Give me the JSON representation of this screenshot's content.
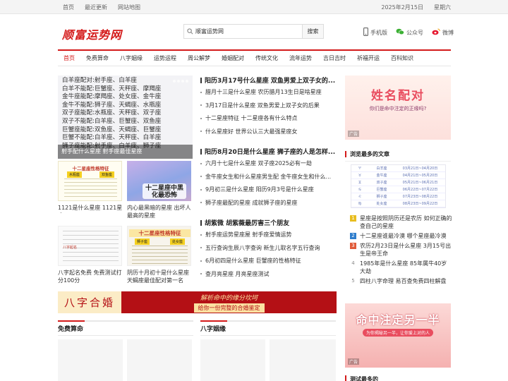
{
  "topbar": {
    "links": [
      "首页",
      "最近更新",
      "网站地图"
    ],
    "date": "2025年2月15日",
    "weekday": "星期六"
  },
  "header": {
    "logo": "顺富运势网",
    "search": {
      "value": "顺富运势网",
      "button": "搜索"
    },
    "links": [
      {
        "icon": "phone-icon",
        "label": "手机版"
      },
      {
        "icon": "wechat-icon",
        "label": "公众号"
      },
      {
        "icon": "weibo-icon",
        "label": "微博"
      }
    ]
  },
  "nav": [
    "首页",
    "免费算命",
    "八字姻缘",
    "运势运程",
    "周公解梦",
    "婚姻配对",
    "传统文化",
    "流年运势",
    "吉日吉时",
    "祈福开运",
    "百科知识"
  ],
  "slider": {
    "lines": [
      "白羊座配对:射手座、白羊座",
      "白羊不能配:巨蟹座、天秤座、摩羯座",
      "金牛座能配:摩羯座、处女座、金牛座",
      "金牛不能配:狮子座、天蝎座、水瓶座",
      "双子座能配:水瓶座、天秤座、双子座",
      "双子不能配:白羊座、巨蟹座、双鱼座",
      "巨蟹座能配:双鱼座、天蝎座、巨蟹座",
      "巨蟹不能配:白羊座、天秤座、白羊座",
      "狮子座能配:射手座、白羊座、狮子座"
    ],
    "caption": "射手配什么星座 射手座最佳星座"
  },
  "thumbs": [
    {
      "caption": "1121是什么星座 1121星座",
      "title": "十二星座性格特征",
      "cols": [
        "水瓶座",
        "双鱼座"
      ]
    },
    {
      "caption": "内心最黑暗的星座 出坏人最高的星座",
      "title": "十二星座中黑化最恐怖"
    },
    {
      "caption": "八字起名免费 免费测试打分100分",
      "title": "八字起名"
    },
    {
      "caption": "阴历十月初十是什么星座 天蝎座最佳配对第一名",
      "title": "十二星座性格特征",
      "cols": [
        "狮子座",
        "处女座"
      ]
    }
  ],
  "middle": [
    {
      "title": "阳历3月17号什么星座 双鱼男爱上双子女的...",
      "items": [
        "腊月十三是什么星座 农历腊月13生日是啥星座",
        "3月17日是什么星座 双鱼男爱上双子女的后果",
        "十二星座特征 十二星座各有什么特点",
        "什么星座好 世界公认三大最强星座女"
      ]
    },
    {
      "title": "阳历8月20日是什么星座 狮子座的人是怎样...",
      "items": [
        "六月十七是什么星座 双子座2025必有一劫",
        "金牛座女生和什么星座男生配 金牛座女生和什么...",
        "9月初三是什么星座 阳历9月3号是什么星座",
        "狮子座最配的星座 成就狮子座的星座"
      ]
    },
    {
      "title": "胡紫微 胡紫薇最厉害三个朋友",
      "items": [
        "射手座运势星座屋 射手座爱情运势",
        "五行查询生辰八字查询 新生儿取名字五行查询",
        "6月初四是什么星座 巨蟹座的性格特征",
        "查月亮星座 月亮星座测试"
      ]
    }
  ],
  "banner": {
    "left": "八字合婚",
    "line1": "解析命中的缘分坎坷",
    "line2": "给你一份完整的合婚鉴定"
  },
  "sections": [
    "免费算命",
    "八字姻缘"
  ],
  "ad1": {
    "title": "姓名配对",
    "subtitle": "你们是命中注定的正缘吗?",
    "badge": "广告"
  },
  "most_read": {
    "title": "浏览最多的文章",
    "table": [
      [
        "♈",
        "白羊座",
        "03月21日~04月20日"
      ],
      [
        "♉",
        "金牛座",
        "04月21日~05月20日"
      ],
      [
        "♊",
        "双子座",
        "05月21日~06月21日"
      ],
      [
        "♋",
        "巨蟹座",
        "06月22日~07月22日"
      ],
      [
        "♌",
        "狮子座",
        "07月23日~08月22日"
      ],
      [
        "♍",
        "处女座",
        "08月23日~09月22日"
      ]
    ],
    "items": [
      {
        "n": "1",
        "text": "星座是按照阴历还是农历 如何正确的查自己的星座"
      },
      {
        "n": "2",
        "text": "十二星座谁最冷漠 哪个星座最冷漠"
      },
      {
        "n": "3",
        "text": "农历2月23日是什么星座 3月15号出生是帝王命"
      },
      {
        "n": "4",
        "text": "1985年是什么星座 85年属牛40岁大劫"
      },
      {
        "n": "5",
        "text": "四柱八字命理 易百查免费四柱解盘"
      }
    ]
  },
  "ad2": {
    "title": "命中注定另一半",
    "subtitle": "为你揭秘另一半，让你爱上对的人",
    "badge": "广告"
  },
  "right_head2": "测试最多的"
}
